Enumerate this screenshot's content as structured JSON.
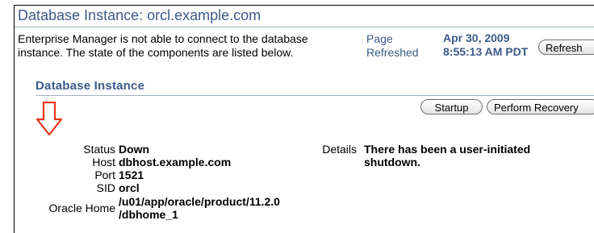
{
  "header": {
    "title": "Database Instance: orcl.example.com"
  },
  "message": {
    "line1": "Enterprise Manager is not able to connect to the database",
    "line2": "instance. The state of the components are listed below."
  },
  "refresh_info": {
    "page_label": "Page",
    "refreshed_label": "Refreshed",
    "date": "Apr 30, 2009",
    "time": "8:55:13 AM PDT",
    "refresh_button": "Refresh"
  },
  "section": {
    "title": "Database Instance",
    "buttons": {
      "startup": "Startup",
      "perform_recovery": "Perform Recovery"
    }
  },
  "properties": {
    "status_label": "Status",
    "status_value": "Down",
    "host_label": "Host",
    "host_value": "dbhost.example.com",
    "port_label": "Port",
    "port_value": "1521",
    "sid_label": "SID",
    "sid_value": "orcl",
    "oracle_home_label": "Oracle Home",
    "oracle_home_value_line1": "/u01/app/oracle/product/11.2.0",
    "oracle_home_value_line2": "/dbhome_1",
    "details_label": "Details",
    "details_value_line1": "There has been a user-initiated",
    "details_value_line2": "shutdown."
  },
  "colors": {
    "title_blue": "#3b5b8a",
    "arrow_red": "#e8381b"
  },
  "icons": {
    "annotation_arrow": "down-arrow-icon"
  }
}
